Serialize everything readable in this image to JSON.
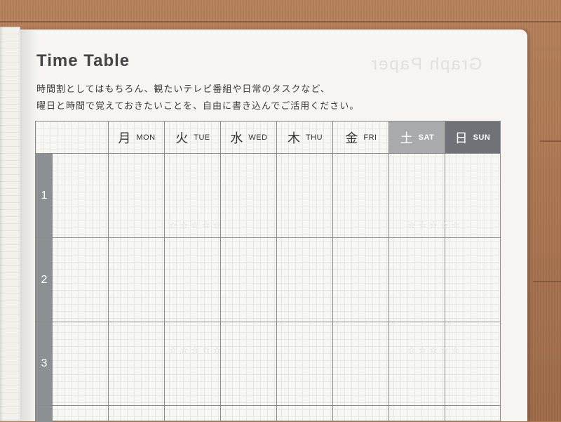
{
  "header": {
    "title": "Time Table",
    "description_line1": "時間割としてはもちろん、観たいテレビ番組や日常のタスクなど、",
    "description_line2": "曜日と時間で覚えておきたいことを、自由に書き込んでご活用ください。",
    "ghost_title": "Graph Paper"
  },
  "days": [
    {
      "kanji": "月",
      "en": "MON"
    },
    {
      "kanji": "火",
      "en": "TUE"
    },
    {
      "kanji": "水",
      "en": "WED"
    },
    {
      "kanji": "木",
      "en": "THU"
    },
    {
      "kanji": "金",
      "en": "FRI"
    },
    {
      "kanji": "土",
      "en": "SAT"
    },
    {
      "kanji": "日",
      "en": "SUN"
    }
  ],
  "periods": [
    "1",
    "2",
    "3"
  ],
  "colors": {
    "saturday_bg": "#a8aaab",
    "sunday_bg": "#6f7276",
    "period_bg": "#8d9092",
    "cover": "#b07a52",
    "paper": "#f6f5f1"
  }
}
